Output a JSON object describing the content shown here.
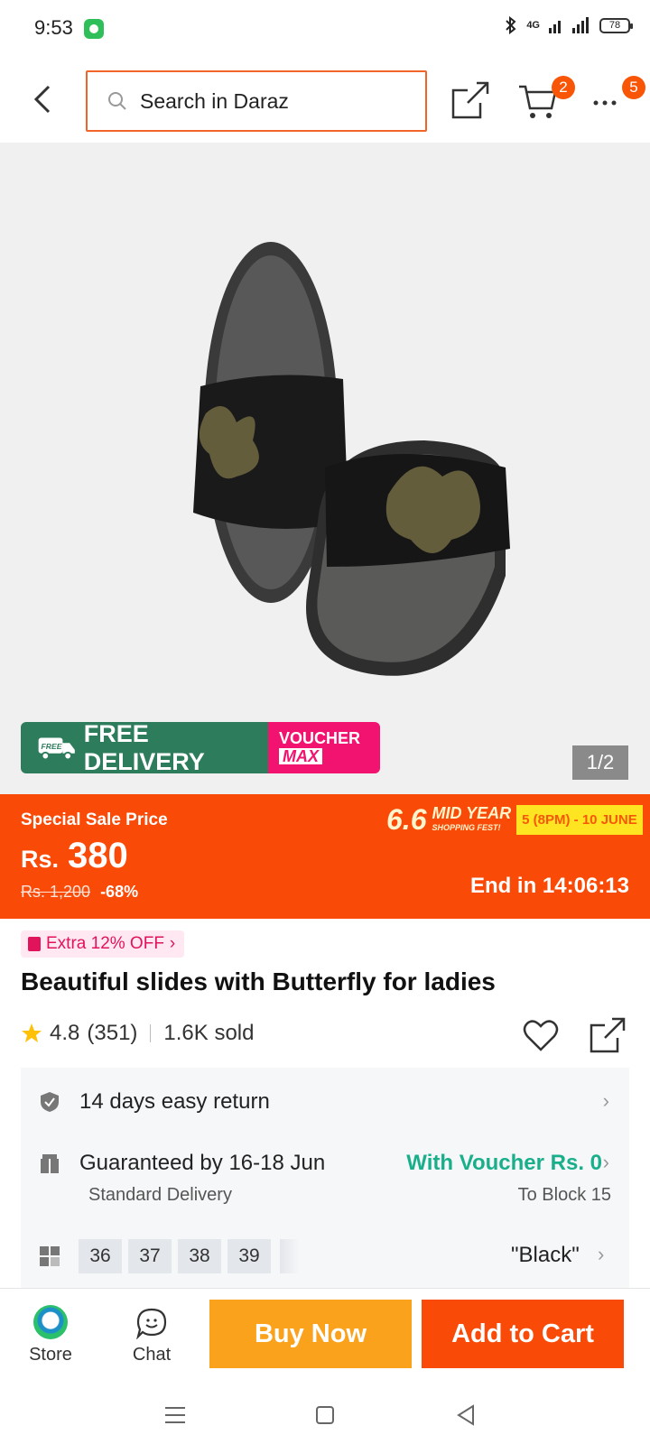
{
  "status_bar": {
    "time": "9:53",
    "network": "4G",
    "battery": "78"
  },
  "header": {
    "search_placeholder": "Search in Daraz",
    "cart_count": "2",
    "more_count": "5"
  },
  "gallery": {
    "promo_free": "FREE DELIVERY",
    "promo_free_tag": "FREE",
    "promo_voucher": "VOUCHER",
    "promo_max": "MAX",
    "page_counter": "1/2"
  },
  "price": {
    "label": "Special Sale Price",
    "currency": "Rs.",
    "value": "380",
    "original": "Rs. 1,200",
    "discount": "-68%",
    "campaign_big": "6.6",
    "campaign_name": "MID YEAR",
    "campaign_sub": "SHOPPING FEST!",
    "campaign_dates": "5 (8PM) - 10 JUNE",
    "countdown": "End in 14:06:13"
  },
  "product": {
    "extra_offer": "Extra 12% OFF",
    "title": "Beautiful slides with Butterfly for ladies",
    "rating": "4.8",
    "reviews": "(351)",
    "sold": "1.6K sold"
  },
  "services": {
    "return": "14 days easy return",
    "delivery": "Guaranteed by 16-18 Jun",
    "delivery_type": "Standard Delivery",
    "voucher": "With Voucher Rs. 0",
    "location": "To Block 15",
    "sizes": [
      "36",
      "37",
      "38",
      "39"
    ],
    "color": "\"Black\""
  },
  "bottom_bar": {
    "store": "Store",
    "chat": "Chat",
    "buy_now": "Buy Now",
    "add_to_cart": "Add to Cart"
  },
  "colors": {
    "brand": "#f85606",
    "price_bg": "#fa4a07",
    "buy_now": "#faa21b",
    "voucher_green": "#1aaf8b"
  }
}
